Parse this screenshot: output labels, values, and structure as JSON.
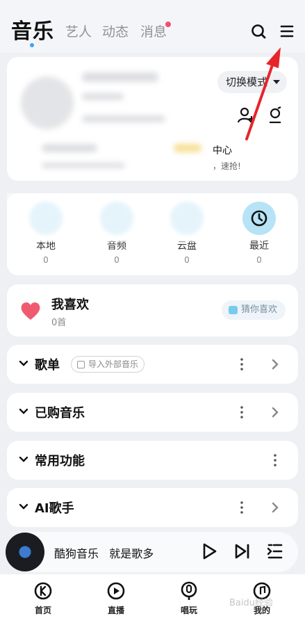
{
  "tabs": {
    "active": "音乐",
    "artist": "艺人",
    "feed": "动态",
    "messages": "消息"
  },
  "profile": {
    "switch_mode": "切换模式",
    "vip_title": "中心",
    "vip_subtitle": "，速抢!"
  },
  "quick_access": [
    {
      "label": "本地",
      "count": "0"
    },
    {
      "label": "音频",
      "count": "0"
    },
    {
      "label": "云盘",
      "count": "0"
    },
    {
      "label": "最近",
      "count": "0"
    }
  ],
  "favorites": {
    "title": "我喜欢",
    "count": "0首",
    "guess_button": "猜你喜欢"
  },
  "sections": [
    {
      "title": "歌单",
      "tag": "导入外部音乐"
    },
    {
      "title": "已购音乐"
    },
    {
      "title": "常用功能"
    },
    {
      "title": "AI歌手"
    }
  ],
  "player": {
    "title": "酷狗音乐",
    "subtitle": "就是歌多"
  },
  "bottom_nav": [
    {
      "label": "首页"
    },
    {
      "label": "直播"
    },
    {
      "label": "唱玩"
    },
    {
      "label": "我的"
    }
  ],
  "watermark": "Baidu经验",
  "colors": {
    "accent_blue": "#3fa0f5",
    "badge_red": "#f0506e",
    "heart_red": "#f05a70",
    "annotation_red": "#e8242b"
  }
}
